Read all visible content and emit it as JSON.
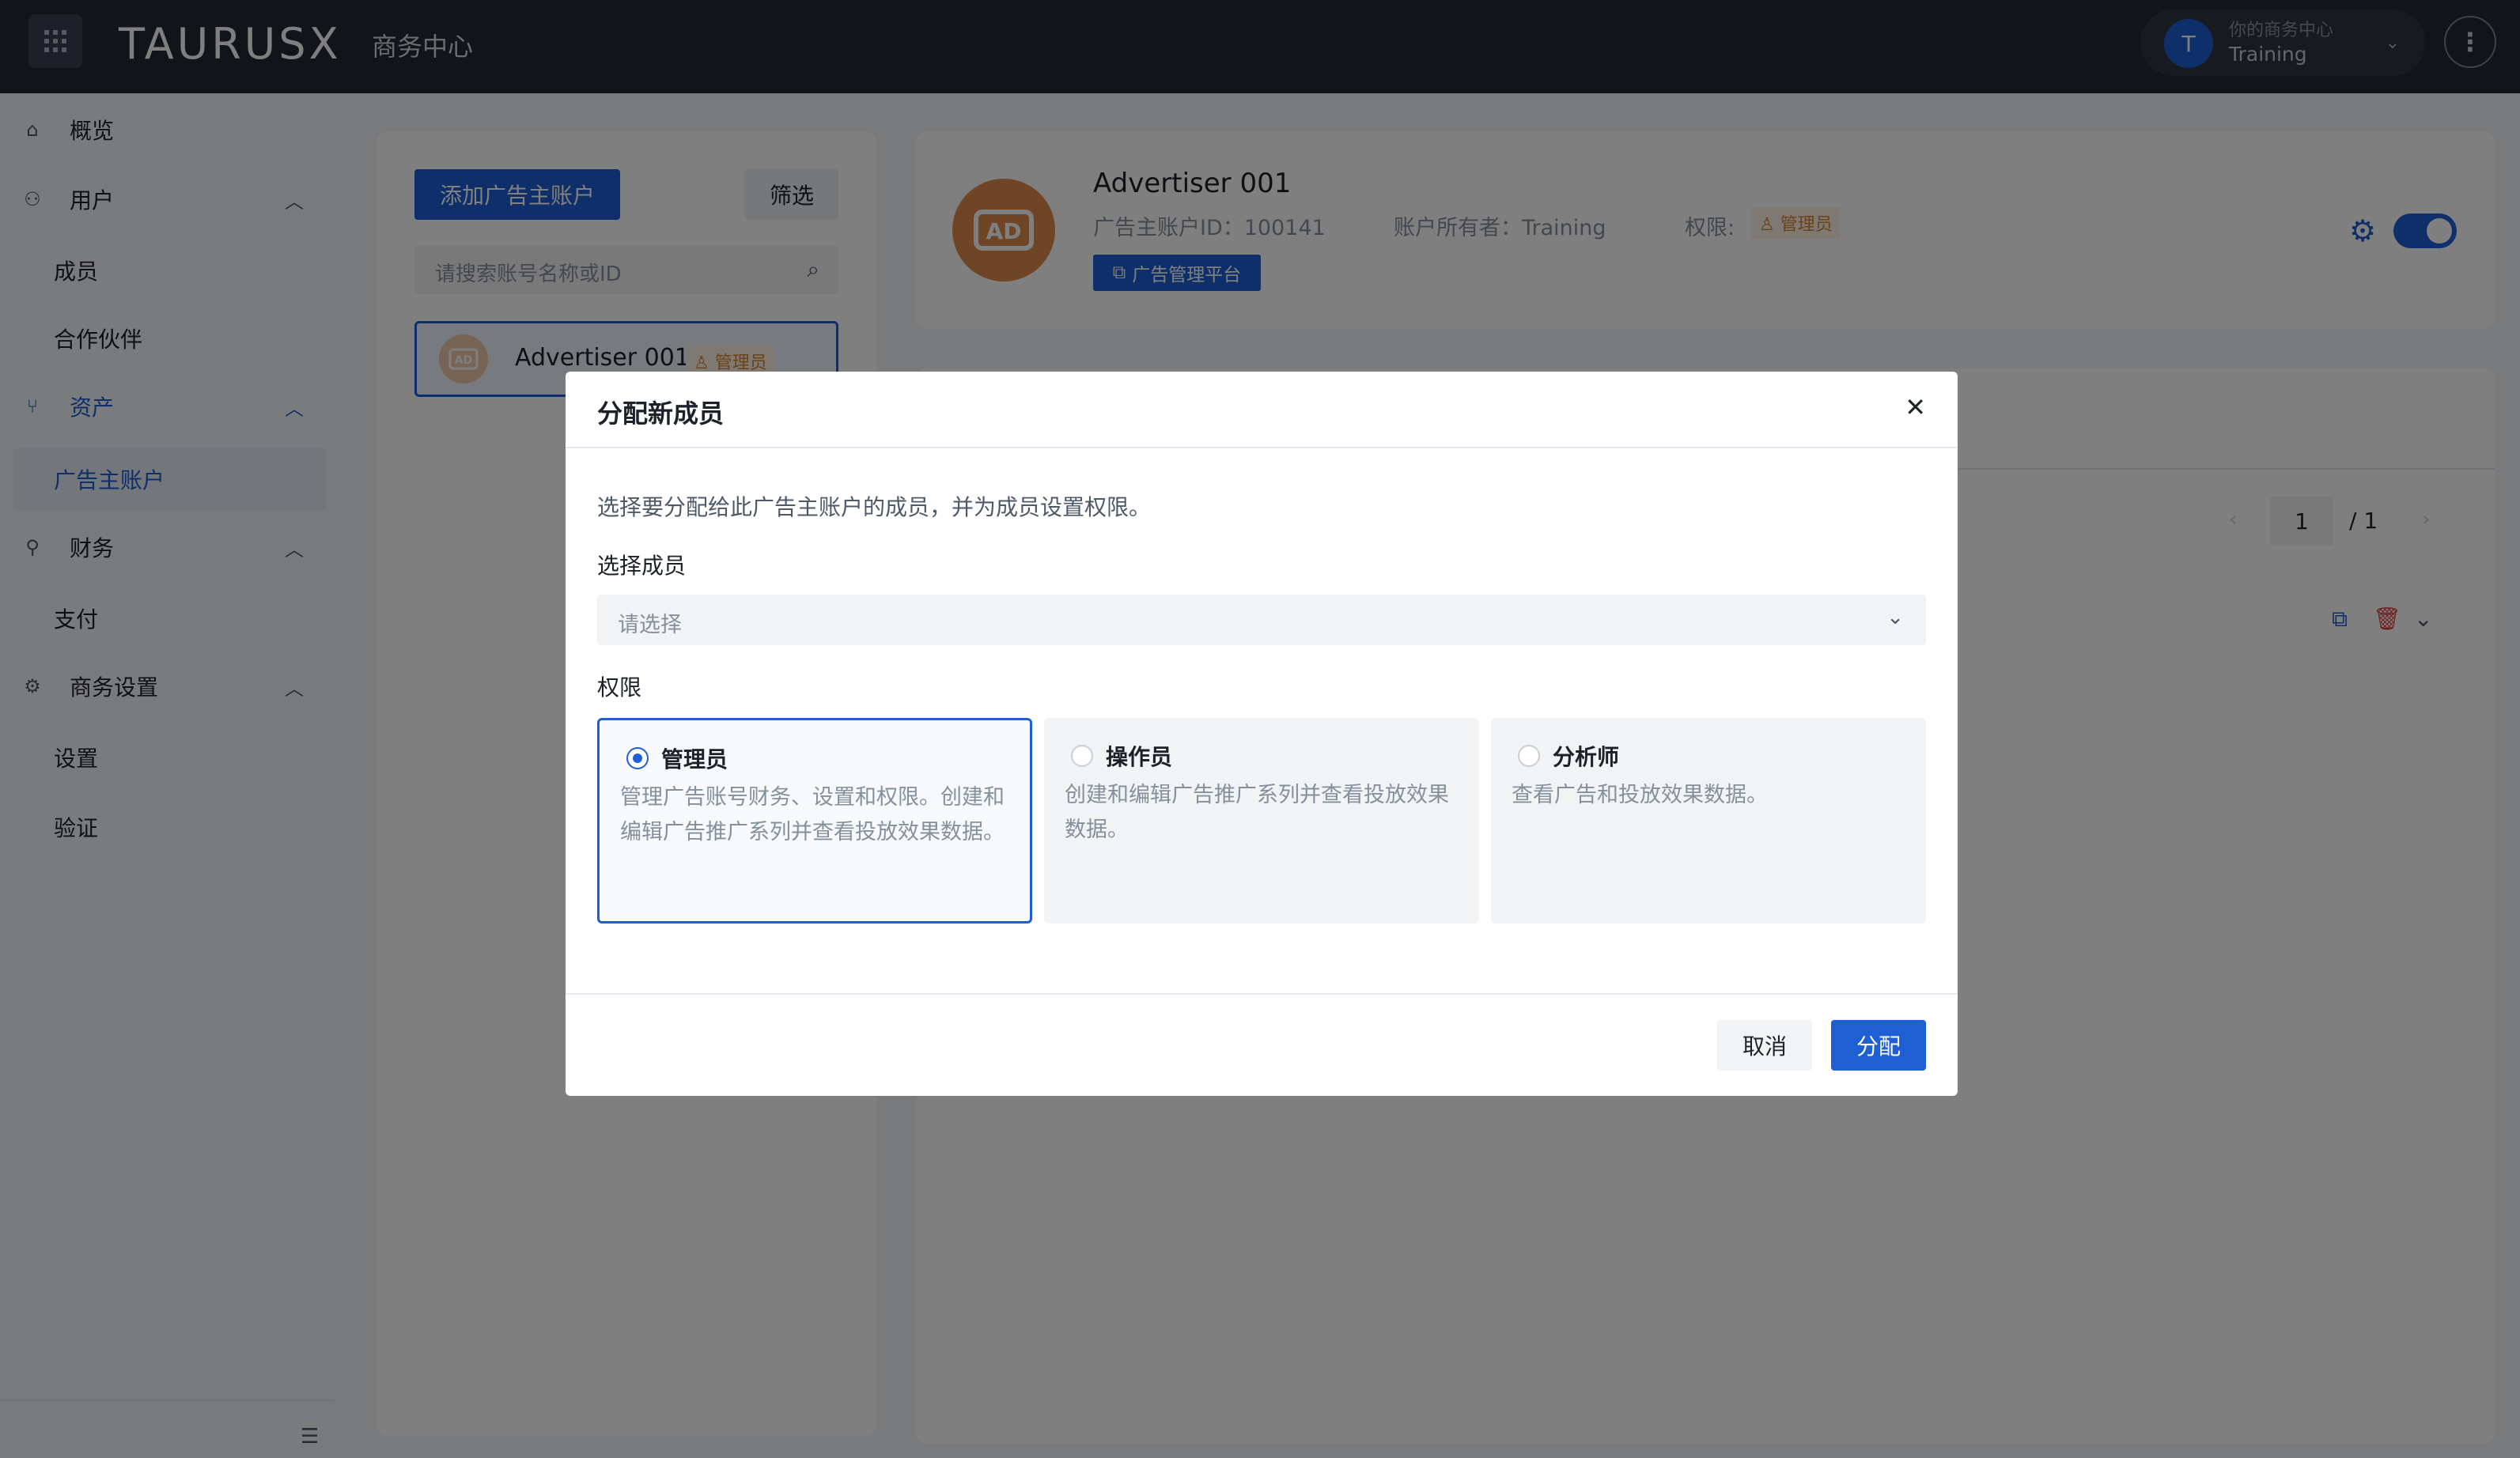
{
  "topbar": {
    "logo": "TAURUSX",
    "logo_sub": "商务中心",
    "account_label": "你的商务中心",
    "account_name": "Training",
    "account_initial": "T"
  },
  "sidebar": {
    "items": [
      {
        "label": "概览",
        "icon": "home-icon"
      },
      {
        "label": "用户",
        "icon": "users-icon"
      },
      {
        "label": "成员"
      },
      {
        "label": "合作伙伴"
      },
      {
        "label": "资产",
        "icon": "branch-icon"
      },
      {
        "label": "广告主账户"
      },
      {
        "label": "财务",
        "icon": "finance-icon"
      },
      {
        "label": "支付"
      },
      {
        "label": "商务设置",
        "icon": "gear-icon"
      },
      {
        "label": "设置"
      },
      {
        "label": "验证"
      }
    ]
  },
  "left_panel": {
    "add_label": "添加广告主账户",
    "filter_label": "筛选",
    "search_placeholder": "请搜索账号名称或ID",
    "accounts": [
      {
        "name": "Advertiser 001",
        "role": "管理员"
      }
    ]
  },
  "account_detail": {
    "name": "Advertiser 001",
    "id_text": "广告主账户ID：100141",
    "owner_text": "账户所有者：Training",
    "permission_label": "权限:",
    "permission_value": "管理员",
    "platform_label": "广告管理平台"
  },
  "pager": {
    "current": "1",
    "total": "/  1"
  },
  "modal": {
    "title": "分配新成员",
    "description": "选择要分配给此广告主账户的成员，并为成员设置权限。",
    "member_label": "选择成员",
    "member_placeholder": "请选择",
    "permission_label": "权限",
    "roles": [
      {
        "name": "管理员",
        "desc": "管理广告账号财务、设置和权限。创建和编辑广告推广系列并查看投放效果数据。",
        "selected": true
      },
      {
        "name": "操作员",
        "desc": "创建和编辑广告推广系列并查看投放效果数据。",
        "selected": false
      },
      {
        "name": "分析师",
        "desc": "查看广告和投放效果数据。",
        "selected": false
      }
    ],
    "cancel_label": "取消",
    "confirm_label": "分配"
  },
  "colors": {
    "accent": "#1f5fd4",
    "topbar": "#222833",
    "tag": "#d9822b"
  }
}
